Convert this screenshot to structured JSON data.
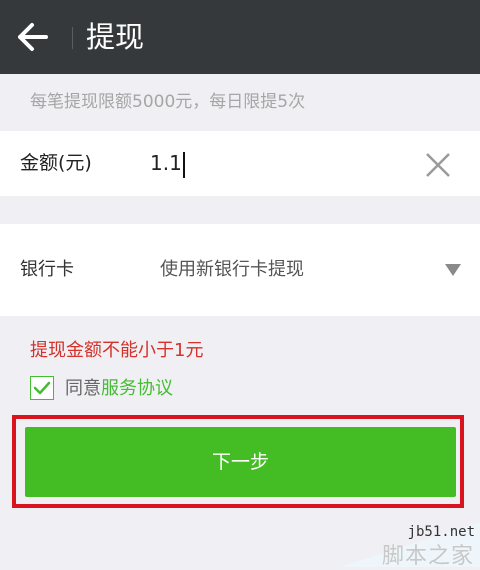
{
  "header": {
    "title": "提现",
    "back_icon": "arrow-left-icon"
  },
  "notice": "每笔提现限额5000元，每日限提5次",
  "amount": {
    "label": "金额(元)",
    "value": "1.1",
    "clear_icon": "close-icon"
  },
  "bank": {
    "label": "银行卡",
    "value": "使用新银行卡提现",
    "dropdown_icon": "triangle-down-icon"
  },
  "error": "提现金额不能小于1元",
  "agreement": {
    "checked": true,
    "prefix": "同意",
    "link": "服务协议"
  },
  "next_button": "下一步",
  "watermark": {
    "url": "jb51.net",
    "name": "脚本之家"
  },
  "colors": {
    "appbar": "#36393b",
    "accent_green": "#44bd24",
    "error_red": "#d4322a",
    "highlight_red": "#d9141e"
  }
}
